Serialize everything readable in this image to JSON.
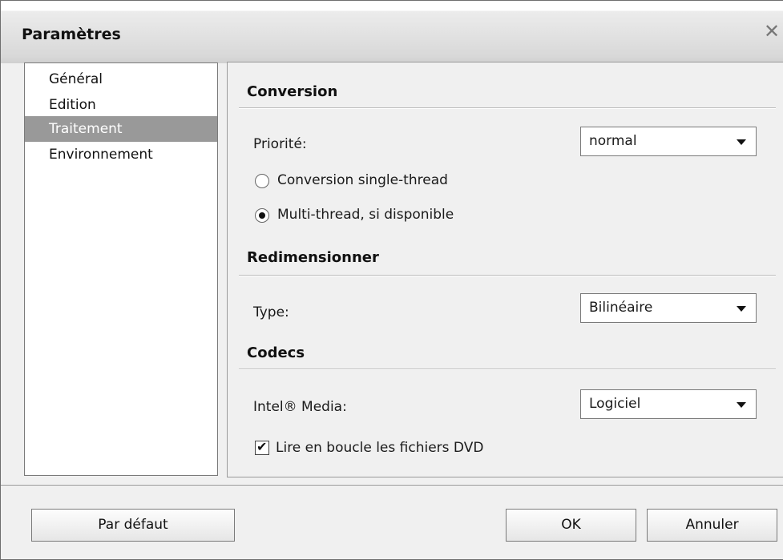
{
  "window": {
    "title": "Paramètres",
    "close_glyph": "✕",
    "close_icon": "close-icon"
  },
  "sidebar": {
    "items": [
      {
        "label": "Général",
        "selected": false
      },
      {
        "label": "Edition",
        "selected": false
      },
      {
        "label": "Traitement",
        "selected": true
      },
      {
        "label": "Environnement",
        "selected": false
      }
    ]
  },
  "conversion": {
    "title": "Conversion",
    "priority_label": "Priorité:",
    "priority_value": "normal",
    "radio_single": "Conversion single-thread",
    "radio_multi": "Multi-thread, si disponible",
    "selected_radio": "multi"
  },
  "resize": {
    "title": "Redimensionner",
    "type_label": "Type:",
    "type_value": "Bilinéaire"
  },
  "codecs": {
    "title": "Codecs",
    "intel_label": "Intel® Media:",
    "intel_value": "Logiciel",
    "loop_label": "Lire en boucle les fichiers DVD",
    "loop_checked": true
  },
  "buttons": {
    "default": "Par défaut",
    "ok": "OK",
    "cancel": "Annuler"
  },
  "colors": {
    "selected_bg": "#999999",
    "dialog_bg": "#f0f0f0"
  }
}
